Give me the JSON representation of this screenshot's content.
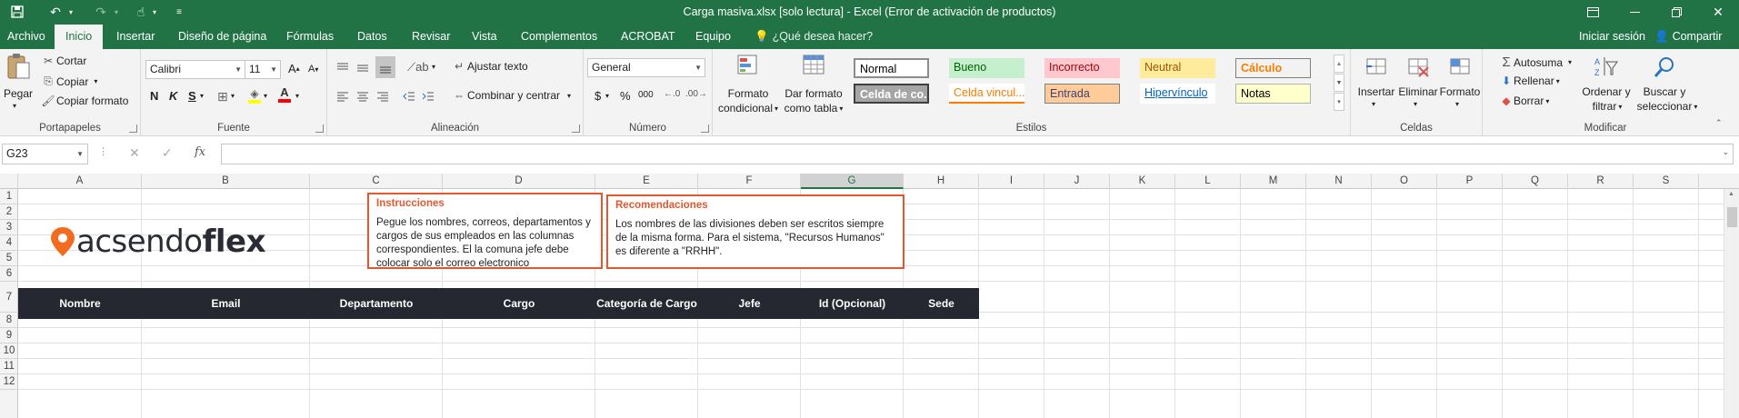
{
  "window": {
    "title": "Carga masiva.xlsx  [solo lectura] - Excel (Error de activación de productos)"
  },
  "tabs": {
    "items": [
      {
        "label": "Archivo"
      },
      {
        "label": "Inicio"
      },
      {
        "label": "Insertar"
      },
      {
        "label": "Diseño de página"
      },
      {
        "label": "Fórmulas"
      },
      {
        "label": "Datos"
      },
      {
        "label": "Revisar"
      },
      {
        "label": "Vista"
      },
      {
        "label": "Complementos"
      },
      {
        "label": "ACROBAT"
      },
      {
        "label": "Equipo"
      }
    ],
    "active": "Inicio",
    "tell_me": "¿Qué desea hacer?",
    "sign_in": "Iniciar sesión",
    "share": "Compartir"
  },
  "ribbon": {
    "portapapeles": {
      "label": "Portapapeles",
      "paste": "Pegar",
      "cut": "Cortar",
      "copy": "Copiar",
      "format_painter": "Copiar formato"
    },
    "fuente": {
      "label": "Fuente",
      "font_name": "Calibri",
      "font_size": "11",
      "bold": "N",
      "italic": "K",
      "underline": "S",
      "grow": "A",
      "shrink": "A"
    },
    "alineacion": {
      "label": "Alineación",
      "wrap_text": "Ajustar texto",
      "merge_center": "Combinar y centrar"
    },
    "numero": {
      "label": "Número",
      "format": "General",
      "currency": "$",
      "percent": "%",
      "thousands": "000"
    },
    "estilos": {
      "label": "Estilos",
      "conditional_line1": "Formato",
      "conditional_line2": "condicional",
      "table_line1": "Dar formato",
      "table_line2": "como tabla",
      "cells": [
        {
          "label": "Normal",
          "bg": "#ffffff",
          "fg": "#000000"
        },
        {
          "label": "Bueno",
          "bg": "#c6efce",
          "fg": "#006100"
        },
        {
          "label": "Incorrecto",
          "bg": "#ffc7ce",
          "fg": "#9c0006"
        },
        {
          "label": "Neutral",
          "bg": "#ffeb9c",
          "fg": "#9c5700"
        },
        {
          "label": "Cálculo",
          "bg": "#f2f2f2",
          "fg": "#fa7d00"
        },
        {
          "label": "Celda de co...",
          "bg": "#a5a5a5",
          "fg": "#ffffff"
        },
        {
          "label": "Celda vincul...",
          "bg": "#ffffff",
          "fg": "#fa7d00"
        },
        {
          "label": "Entrada",
          "bg": "#ffcc99",
          "fg": "#3f3f76"
        },
        {
          "label": "Hipervínculo",
          "bg": "#ffffff",
          "fg": "#0563c1"
        },
        {
          "label": "Notas",
          "bg": "#ffffcc",
          "fg": "#000000"
        }
      ]
    },
    "celdas": {
      "label": "Celdas",
      "insert": "Insertar",
      "delete": "Eliminar",
      "format": "Formato"
    },
    "modificar": {
      "label": "Modificar",
      "autosum": "Autosuma",
      "fill": "Rellenar",
      "clear": "Borrar",
      "sort_line1": "Ordenar y",
      "sort_line2": "filtrar",
      "find_line1": "Buscar y",
      "find_line2": "seleccionar"
    }
  },
  "formula_bar": {
    "name_box": "G23",
    "fx": "fx",
    "value": ""
  },
  "grid": {
    "columns": [
      "A",
      "B",
      "C",
      "D",
      "E",
      "F",
      "G",
      "H",
      "I",
      "J",
      "K",
      "L",
      "M",
      "N",
      "O",
      "P",
      "Q",
      "R",
      "S"
    ],
    "selected_column": "G",
    "rows": [
      "1",
      "2",
      "3",
      "4",
      "5",
      "6",
      "7",
      "8",
      "9",
      "10",
      "11",
      "12"
    ],
    "logo": {
      "light": "acsendo",
      "bold": "flex"
    },
    "instructions": {
      "title": "Instrucciones",
      "text": "Pegue los nombres, correos, departamentos y cargos de sus empleados en las columnas correspondientes.  El la comuna jefe debe colocar solo el correo electronico"
    },
    "recommendations": {
      "title": "Recomendaciones",
      "text": "Los nombres de las divisiones deben ser escritos siempre de la misma forma. Para el sistema, \"Recursos Humanos\" es diferente a \"RRHH\"."
    },
    "headers": [
      "Nombre",
      "Email",
      "Departamento",
      "Cargo",
      "Categoría de Cargo",
      "Jefe",
      "Id (Opcional)",
      "Sede"
    ]
  },
  "colors": {
    "accent": "#217346",
    "header_row_bg": "#262831",
    "box_border": "#e2572e",
    "logo_pin": "#f26b21"
  }
}
